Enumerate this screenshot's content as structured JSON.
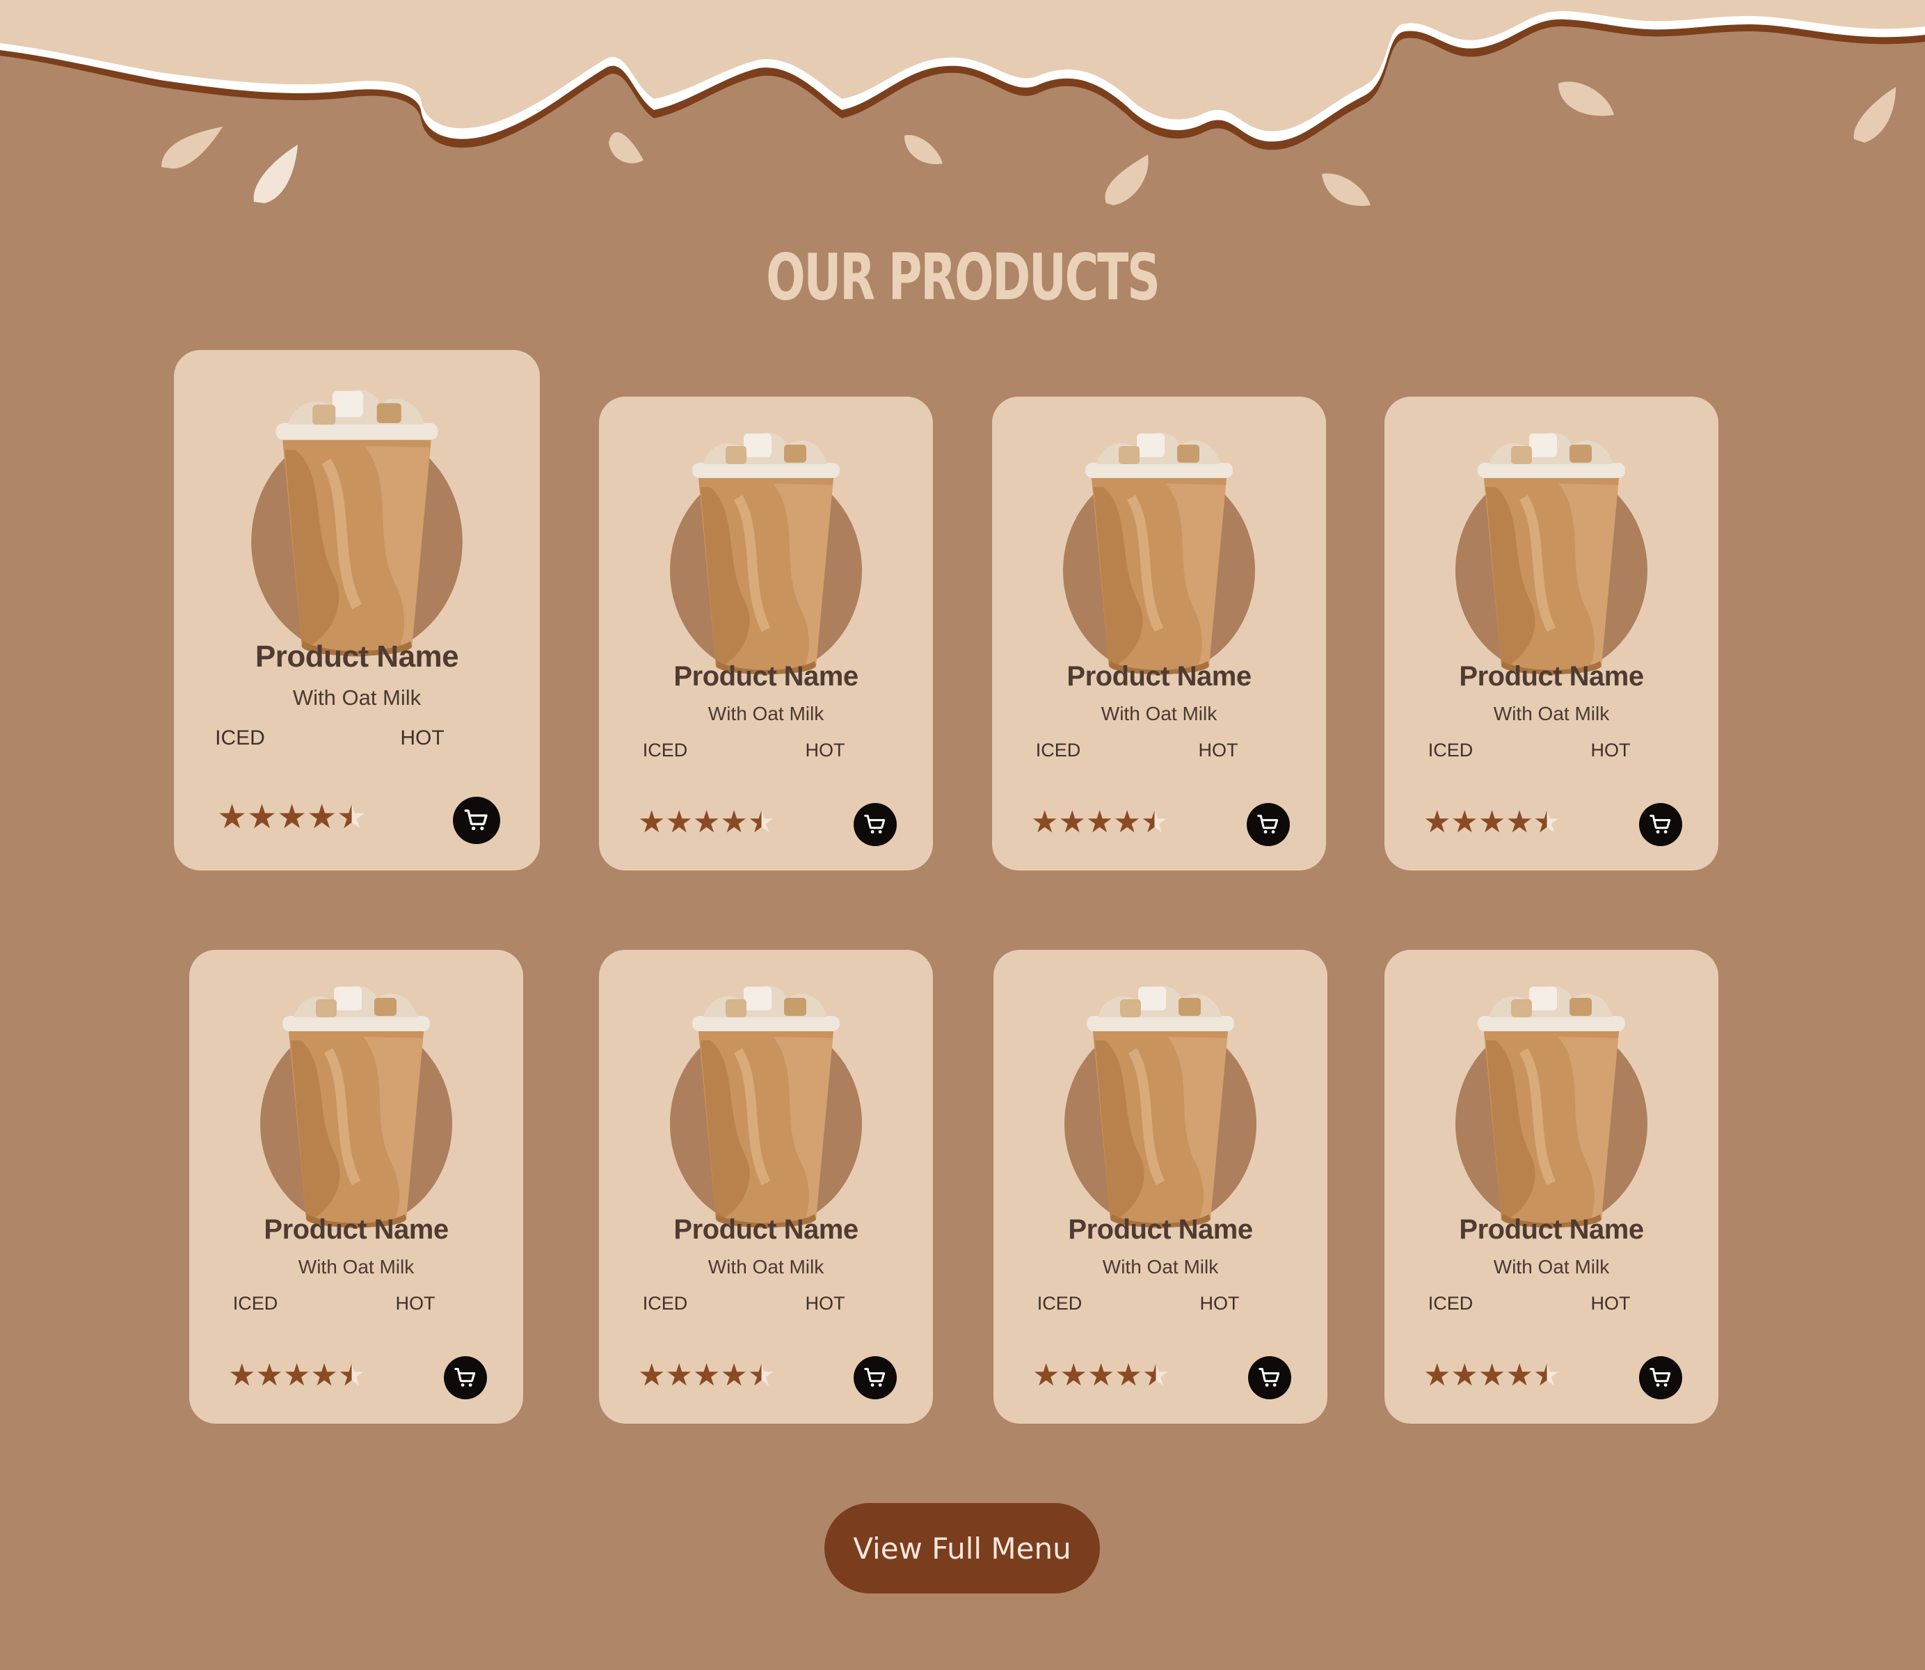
{
  "section": {
    "title": "OUR PRODUCTS"
  },
  "colors": {
    "background": "#af8668",
    "cream": "#e6ccb2",
    "chocolate": "#8a4a24",
    "button": "#7a3e1e",
    "text_dark": "#4f3b32"
  },
  "products": [
    {
      "name": "Product Name",
      "subtitle": "With Oat Milk",
      "option_iced": "ICED",
      "option_hot": "HOT",
      "rating": 4.5,
      "cart_icon": "shopping-cart-icon"
    },
    {
      "name": "Product Name",
      "subtitle": "With Oat Milk",
      "option_iced": "ICED",
      "option_hot": "HOT",
      "rating": 4.5,
      "cart_icon": "shopping-cart-icon"
    },
    {
      "name": "Product Name",
      "subtitle": "With Oat Milk",
      "option_iced": "ICED",
      "option_hot": "HOT",
      "rating": 4.5,
      "cart_icon": "shopping-cart-icon"
    },
    {
      "name": "Product Name",
      "subtitle": "With Oat Milk",
      "option_iced": "ICED",
      "option_hot": "HOT",
      "rating": 4.5,
      "cart_icon": "shopping-cart-icon"
    },
    {
      "name": "Product Name",
      "subtitle": "With Oat Milk",
      "option_iced": "ICED",
      "option_hot": "HOT",
      "rating": 4.5,
      "cart_icon": "shopping-cart-icon"
    },
    {
      "name": "Product Name",
      "subtitle": "With Oat Milk",
      "option_iced": "ICED",
      "option_hot": "HOT",
      "rating": 4.5,
      "cart_icon": "shopping-cart-icon"
    },
    {
      "name": "Product Name",
      "subtitle": "With Oat Milk",
      "option_iced": "ICED",
      "option_hot": "HOT",
      "rating": 4.5,
      "cart_icon": "shopping-cart-icon"
    },
    {
      "name": "Product Name",
      "subtitle": "With Oat Milk",
      "option_iced": "ICED",
      "option_hot": "HOT",
      "rating": 4.5,
      "cart_icon": "shopping-cart-icon"
    }
  ],
  "cta": {
    "label": "View Full Menu"
  }
}
